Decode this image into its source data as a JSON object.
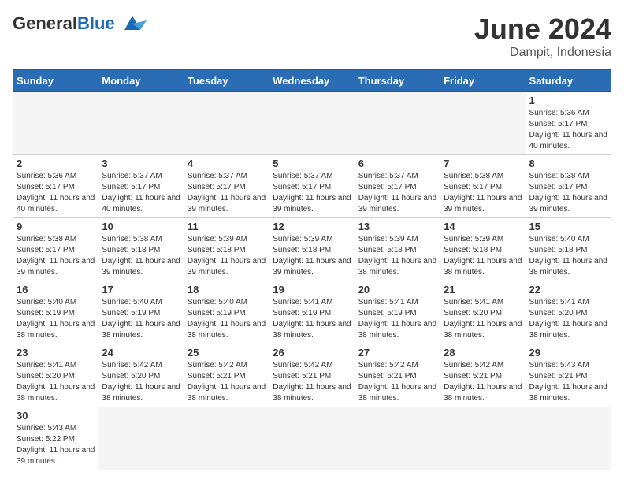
{
  "header": {
    "logo_general": "General",
    "logo_blue": "Blue",
    "month_title": "June 2024",
    "subtitle": "Dampit, Indonesia"
  },
  "days_of_week": [
    "Sunday",
    "Monday",
    "Tuesday",
    "Wednesday",
    "Thursday",
    "Friday",
    "Saturday"
  ],
  "weeks": [
    [
      {
        "day": "",
        "info": ""
      },
      {
        "day": "",
        "info": ""
      },
      {
        "day": "",
        "info": ""
      },
      {
        "day": "",
        "info": ""
      },
      {
        "day": "",
        "info": ""
      },
      {
        "day": "",
        "info": ""
      },
      {
        "day": "1",
        "info": "Sunrise: 5:36 AM\nSunset: 5:17 PM\nDaylight: 11 hours and 40 minutes."
      }
    ],
    [
      {
        "day": "2",
        "info": "Sunrise: 5:36 AM\nSunset: 5:17 PM\nDaylight: 11 hours and 40 minutes."
      },
      {
        "day": "3",
        "info": "Sunrise: 5:37 AM\nSunset: 5:17 PM\nDaylight: 11 hours and 40 minutes."
      },
      {
        "day": "4",
        "info": "Sunrise: 5:37 AM\nSunset: 5:17 PM\nDaylight: 11 hours and 39 minutes."
      },
      {
        "day": "5",
        "info": "Sunrise: 5:37 AM\nSunset: 5:17 PM\nDaylight: 11 hours and 39 minutes."
      },
      {
        "day": "6",
        "info": "Sunrise: 5:37 AM\nSunset: 5:17 PM\nDaylight: 11 hours and 39 minutes."
      },
      {
        "day": "7",
        "info": "Sunrise: 5:38 AM\nSunset: 5:17 PM\nDaylight: 11 hours and 39 minutes."
      },
      {
        "day": "8",
        "info": "Sunrise: 5:38 AM\nSunset: 5:17 PM\nDaylight: 11 hours and 39 minutes."
      }
    ],
    [
      {
        "day": "9",
        "info": "Sunrise: 5:38 AM\nSunset: 5:17 PM\nDaylight: 11 hours and 39 minutes."
      },
      {
        "day": "10",
        "info": "Sunrise: 5:38 AM\nSunset: 5:18 PM\nDaylight: 11 hours and 39 minutes."
      },
      {
        "day": "11",
        "info": "Sunrise: 5:39 AM\nSunset: 5:18 PM\nDaylight: 11 hours and 39 minutes."
      },
      {
        "day": "12",
        "info": "Sunrise: 5:39 AM\nSunset: 5:18 PM\nDaylight: 11 hours and 39 minutes."
      },
      {
        "day": "13",
        "info": "Sunrise: 5:39 AM\nSunset: 5:18 PM\nDaylight: 11 hours and 38 minutes."
      },
      {
        "day": "14",
        "info": "Sunrise: 5:39 AM\nSunset: 5:18 PM\nDaylight: 11 hours and 38 minutes."
      },
      {
        "day": "15",
        "info": "Sunrise: 5:40 AM\nSunset: 5:18 PM\nDaylight: 11 hours and 38 minutes."
      }
    ],
    [
      {
        "day": "16",
        "info": "Sunrise: 5:40 AM\nSunset: 5:19 PM\nDaylight: 11 hours and 38 minutes."
      },
      {
        "day": "17",
        "info": "Sunrise: 5:40 AM\nSunset: 5:19 PM\nDaylight: 11 hours and 38 minutes."
      },
      {
        "day": "18",
        "info": "Sunrise: 5:40 AM\nSunset: 5:19 PM\nDaylight: 11 hours and 38 minutes."
      },
      {
        "day": "19",
        "info": "Sunrise: 5:41 AM\nSunset: 5:19 PM\nDaylight: 11 hours and 38 minutes."
      },
      {
        "day": "20",
        "info": "Sunrise: 5:41 AM\nSunset: 5:19 PM\nDaylight: 11 hours and 38 minutes."
      },
      {
        "day": "21",
        "info": "Sunrise: 5:41 AM\nSunset: 5:20 PM\nDaylight: 11 hours and 38 minutes."
      },
      {
        "day": "22",
        "info": "Sunrise: 5:41 AM\nSunset: 5:20 PM\nDaylight: 11 hours and 38 minutes."
      }
    ],
    [
      {
        "day": "23",
        "info": "Sunrise: 5:41 AM\nSunset: 5:20 PM\nDaylight: 11 hours and 38 minutes."
      },
      {
        "day": "24",
        "info": "Sunrise: 5:42 AM\nSunset: 5:20 PM\nDaylight: 11 hours and 38 minutes."
      },
      {
        "day": "25",
        "info": "Sunrise: 5:42 AM\nSunset: 5:21 PM\nDaylight: 11 hours and 38 minutes."
      },
      {
        "day": "26",
        "info": "Sunrise: 5:42 AM\nSunset: 5:21 PM\nDaylight: 11 hours and 38 minutes."
      },
      {
        "day": "27",
        "info": "Sunrise: 5:42 AM\nSunset: 5:21 PM\nDaylight: 11 hours and 38 minutes."
      },
      {
        "day": "28",
        "info": "Sunrise: 5:42 AM\nSunset: 5:21 PM\nDaylight: 11 hours and 38 minutes."
      },
      {
        "day": "29",
        "info": "Sunrise: 5:43 AM\nSunset: 5:21 PM\nDaylight: 11 hours and 38 minutes."
      }
    ],
    [
      {
        "day": "30",
        "info": "Sunrise: 5:43 AM\nSunset: 5:22 PM\nDaylight: 11 hours and 39 minutes."
      },
      {
        "day": "",
        "info": ""
      },
      {
        "day": "",
        "info": ""
      },
      {
        "day": "",
        "info": ""
      },
      {
        "day": "",
        "info": ""
      },
      {
        "day": "",
        "info": ""
      },
      {
        "day": "",
        "info": ""
      }
    ]
  ]
}
